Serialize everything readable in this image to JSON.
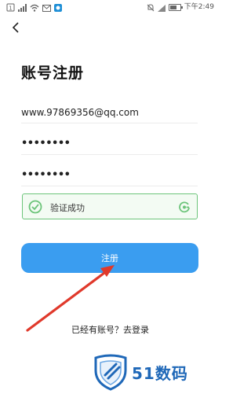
{
  "status_bar": {
    "time": "下午2:49",
    "battery_level": 0.7,
    "icons": [
      "notification-badge-icon",
      "cellular-signal-icon",
      "wifi-icon",
      "mail-icon",
      "app-icon",
      "mute-icon",
      "signal-icon",
      "battery-icon"
    ]
  },
  "nav": {
    "back_icon": "chevron-left-icon"
  },
  "page": {
    "title": "账号注册"
  },
  "form": {
    "email_value": "www.97869356@qq.com",
    "password_dots": "••••••••",
    "confirm_password_dots": "••••••••",
    "captcha_text": "验证成功",
    "register_label": "注册",
    "login_prompt": "已经有账号？去登录"
  },
  "watermark": {
    "text": "51数码"
  },
  "colors": {
    "accent": "#3a9df0",
    "success_green": "#6cc47a",
    "annotation_arrow": "#e0392b",
    "watermark_blue": "#1f68b8"
  }
}
